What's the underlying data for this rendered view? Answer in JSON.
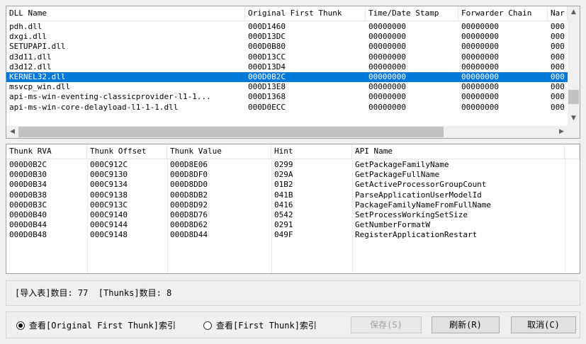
{
  "dll_table": {
    "headers": [
      "DLL Name",
      "Original First Thunk",
      "Time/Date Stamp",
      "Forwarder Chain",
      "Nar"
    ],
    "rows": [
      [
        "pdh.dll",
        "000D1460",
        "00000000",
        "00000000",
        "000"
      ],
      [
        "dxgi.dll",
        "000D13DC",
        "00000000",
        "00000000",
        "000"
      ],
      [
        "SETUPAPI.dll",
        "000D0B80",
        "00000000",
        "00000000",
        "000"
      ],
      [
        "d3d11.dll",
        "000D13CC",
        "00000000",
        "00000000",
        "000"
      ],
      [
        "d3d12.dll",
        "000D13D4",
        "00000000",
        "00000000",
        "000"
      ],
      [
        "KERNEL32.dll",
        "000D0B2C",
        "00000000",
        "00000000",
        "000"
      ],
      [
        "msvcp_win.dll",
        "000D13E8",
        "00000000",
        "00000000",
        "000"
      ],
      [
        "api-ms-win-eventing-classicprovider-l1-1...",
        "000D1368",
        "00000000",
        "00000000",
        "000"
      ],
      [
        "api-ms-win-core-delayload-l1-1-1.dll",
        "000D0ECC",
        "00000000",
        "00000000",
        "000"
      ]
    ],
    "selected_index": 5
  },
  "thunk_table": {
    "headers": [
      "Thunk RVA",
      "Thunk Offset",
      "Thunk Value",
      "Hint",
      "API Name"
    ],
    "rows": [
      [
        "000D0B2C",
        "000C912C",
        "000D8E06",
        "0299",
        "GetPackageFamilyName"
      ],
      [
        "000D0B30",
        "000C9130",
        "000D8DF0",
        "029A",
        "GetPackageFullName"
      ],
      [
        "000D0B34",
        "000C9134",
        "000D8DD0",
        "01B2",
        "GetActiveProcessorGroupCount"
      ],
      [
        "000D0B38",
        "000C9138",
        "000D8DB2",
        "041B",
        "ParseApplicationUserModelId"
      ],
      [
        "000D0B3C",
        "000C913C",
        "000D8D92",
        "0416",
        "PackageFamilyNameFromFullName"
      ],
      [
        "000D0B40",
        "000C9140",
        "000D8D76",
        "0542",
        "SetProcessWorkingSetSize"
      ],
      [
        "000D0B44",
        "000C9144",
        "000D8D62",
        "0291",
        "GetNumberFormatW"
      ],
      [
        "000D0B48",
        "000C9148",
        "000D8D44",
        "049F",
        "RegisterApplicationRestart"
      ]
    ]
  },
  "status": {
    "text": "[导入表]数目: 77  [Thunks]数目: 8"
  },
  "options": {
    "radio_original": "查看[Original First Thunk]索引",
    "radio_first": "查看[First Thunk]索引",
    "save_label": "保存(S)",
    "refresh_label": "刷新(R)",
    "cancel_label": "取消(C)"
  },
  "icons": {
    "up": "chevron-up-icon",
    "down": "chevron-down-icon",
    "left": "chevron-left-icon",
    "right": "chevron-right-icon"
  },
  "colors": {
    "selection": "#0078d7"
  }
}
